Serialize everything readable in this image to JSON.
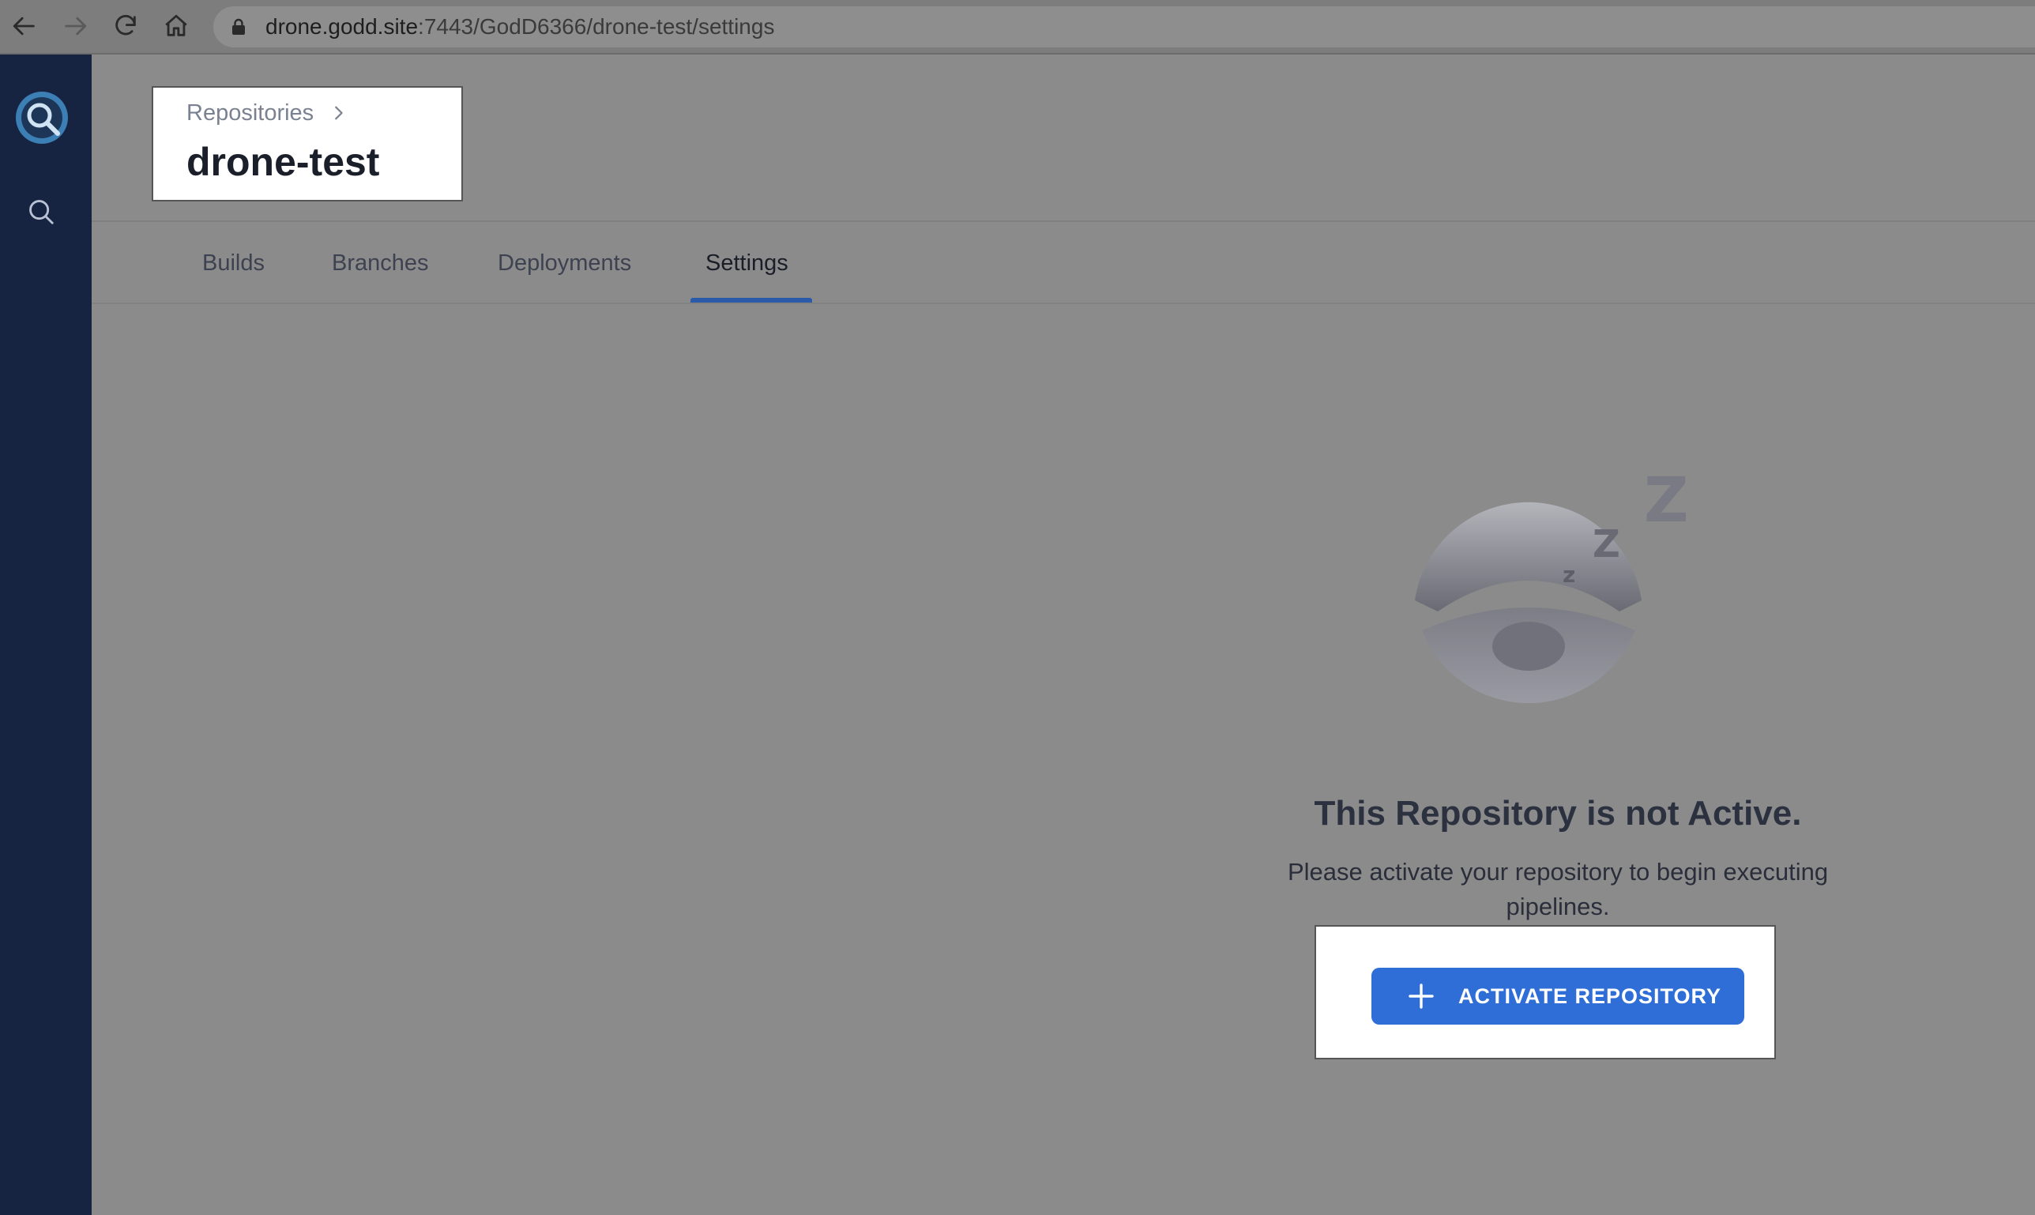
{
  "browser": {
    "url_host": "drone.godd.site",
    "url_path": ":7443/GodD6366/drone-test/settings"
  },
  "header": {
    "breadcrumb": "Repositories",
    "title": "drone-test"
  },
  "tabs": [
    {
      "label": "Builds",
      "active": false
    },
    {
      "label": "Branches",
      "active": false
    },
    {
      "label": "Deployments",
      "active": false
    },
    {
      "label": "Settings",
      "active": true
    }
  ],
  "empty_state": {
    "title": "This Repository is not Active.",
    "description": "Please activate your repository to begin executing pipelines.",
    "button_label": "ACTIVATE REPOSITORY"
  },
  "icons": {
    "back": "back-arrow-icon",
    "forward": "forward-arrow-icon",
    "reload": "reload-icon",
    "home": "home-icon",
    "lock": "lock-icon",
    "logo": "drone-logo-icon",
    "search": "search-icon",
    "breadcrumb_separator": "chevron-right-icon",
    "add": "plus-icon"
  },
  "colors": {
    "sidebar": "#162442",
    "accent": "#2e6ed6",
    "tab_indicator": "#2b5aa8"
  }
}
